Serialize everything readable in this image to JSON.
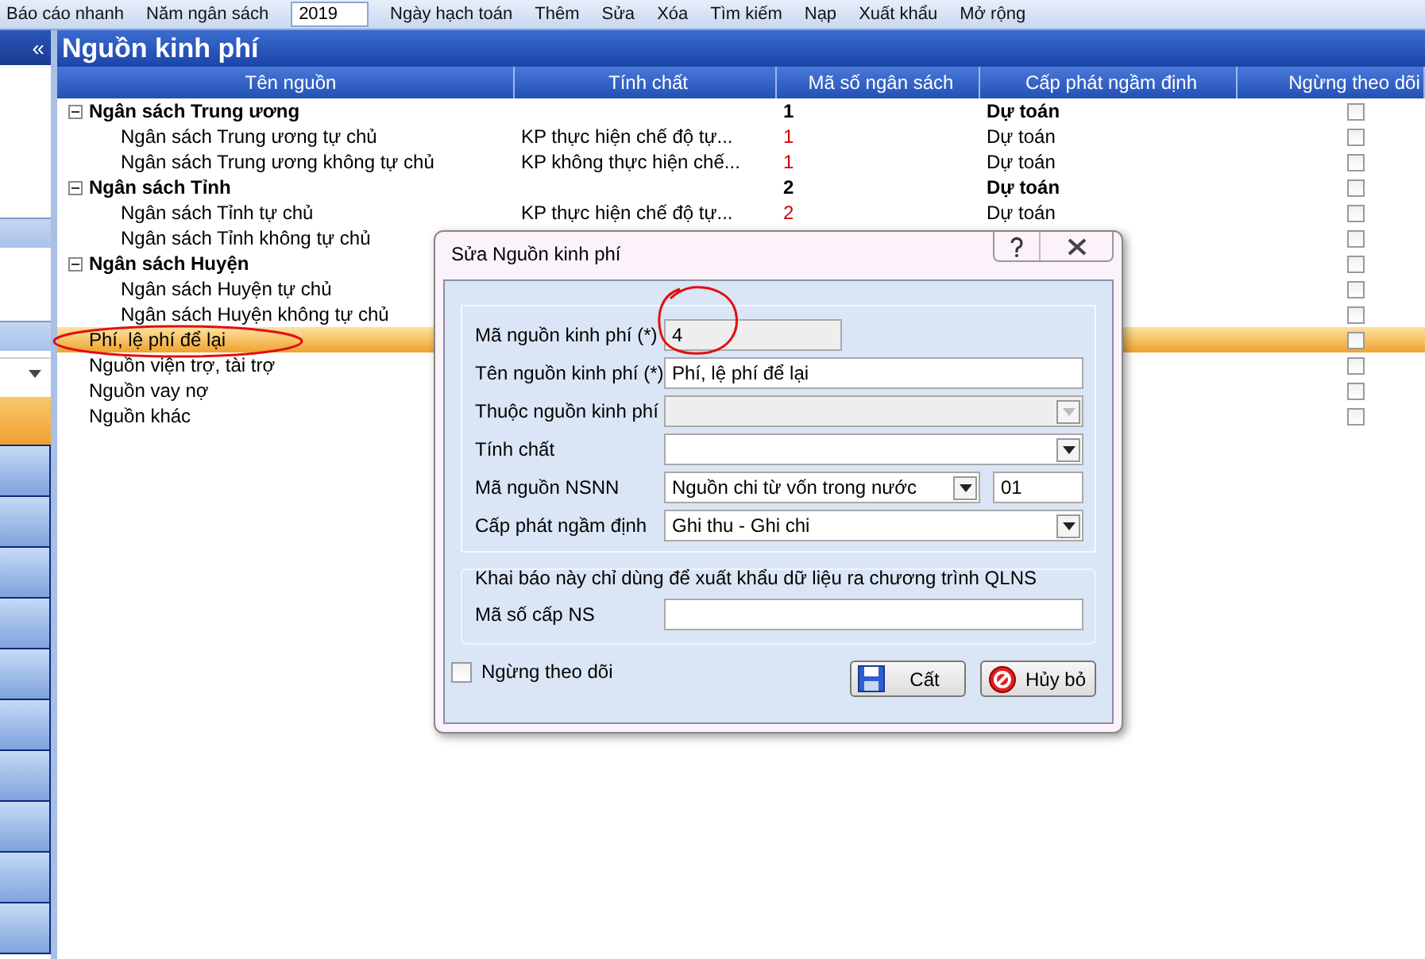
{
  "toolbar": {
    "items": [
      {
        "kind": "button",
        "label": "Báo cáo nhanh"
      },
      {
        "kind": "button",
        "label": "Năm ngân sách"
      },
      {
        "kind": "field",
        "value": "2019"
      },
      {
        "kind": "button",
        "label": "Ngày hạch toán"
      },
      {
        "kind": "button",
        "label": "Thêm"
      },
      {
        "kind": "button",
        "label": "Sửa"
      },
      {
        "kind": "button",
        "label": "Xóa"
      },
      {
        "kind": "button",
        "label": "Tìm kiếm"
      },
      {
        "kind": "button",
        "label": "Nạp"
      },
      {
        "kind": "button",
        "label": "Xuất khẩu"
      },
      {
        "kind": "button",
        "label": "Mở rộng"
      }
    ]
  },
  "sidebar": {
    "collapse": "«"
  },
  "page": {
    "title": "Nguồn kinh phí"
  },
  "table": {
    "columns": [
      "Tên nguồn",
      "Tính chất",
      "Mã số ngân sách",
      "Cấp phát ngầm định",
      "Ngừng theo dõi"
    ],
    "rows": [
      {
        "name": "Ngân sách Trung ương",
        "code": "1",
        "allocation": "Dự toán",
        "stopped": false,
        "selected": false,
        "expanded": true,
        "children": [
          {
            "name": "Ngân sách Trung ương tự chủ",
            "nature": "KP thực hiện chế độ tự...",
            "code": "1",
            "allocation": "Dự toán",
            "stopped": false,
            "selected": false
          },
          {
            "name": "Ngân sách Trung ương không tự chủ",
            "nature": "KP không thực hiện chế...",
            "code": "1",
            "allocation": "Dự toán",
            "stopped": false,
            "selected": false
          }
        ]
      },
      {
        "name": "Ngân sách Tỉnh",
        "code": "2",
        "allocation": "Dự toán",
        "stopped": false,
        "selected": false,
        "expanded": true,
        "children": [
          {
            "name": "Ngân sách Tỉnh tự chủ",
            "nature": "KP thực hiện chế độ tự...",
            "code": "2",
            "allocation": "Dự toán",
            "stopped": false,
            "selected": false
          },
          {
            "name": "Ngân sách Tỉnh không tự chủ",
            "stopped": false,
            "selected": false
          }
        ]
      },
      {
        "name": "Ngân sách Huyện",
        "stopped": false,
        "selected": false,
        "expanded": true,
        "children": [
          {
            "name": "Ngân sách Huyện tự chủ",
            "stopped": false,
            "selected": false
          },
          {
            "name": "Ngân sách Huyện không tự chủ",
            "stopped": false,
            "selected": false
          }
        ]
      },
      {
        "name": "Phí, lệ phí để lại",
        "stopped": false,
        "selected": true
      },
      {
        "name": "Nguồn viện trợ, tài trợ",
        "stopped": false,
        "selected": false
      },
      {
        "name": "Nguồn vay nợ",
        "stopped": false,
        "selected": false
      },
      {
        "name": "Nguồn khác",
        "stopped": false,
        "selected": false
      }
    ]
  },
  "dialog": {
    "title": "Sửa Nguồn kinh phí",
    "fields": [
      {
        "label": "Mã nguồn kinh phí (*)",
        "kind": "readonly",
        "value": "4"
      },
      {
        "label": "Tên nguồn kinh phí (*)",
        "kind": "text",
        "value": "Phí, lệ phí để lại"
      },
      {
        "label": "Thuộc nguồn kinh phí",
        "kind": "select",
        "disabled": true
      },
      {
        "label": "Tính chất",
        "kind": "select",
        "disabled": false
      },
      {
        "label": "Mã nguồn NSNN",
        "kind": "select",
        "disabled": false,
        "value": "Nguồn chi từ vốn trong nước",
        "code": "01"
      },
      {
        "label": "Cấp phát ngầm định",
        "kind": "select",
        "disabled": false,
        "value": "Ghi thu - Ghi chi"
      }
    ],
    "export_group": {
      "legend": "Khai báo này chỉ dùng để xuất khẩu dữ liệu ra chương trình QLNS",
      "fields": [
        {
          "label": "Mã số cấp NS",
          "kind": "text"
        }
      ]
    },
    "stop_tracking": {
      "label": "Ngừng theo dõi",
      "checked": false
    },
    "buttons": [
      {
        "kind": "save",
        "label": "Cất"
      },
      {
        "kind": "cancel",
        "label": "Hủy bỏ"
      }
    ]
  }
}
